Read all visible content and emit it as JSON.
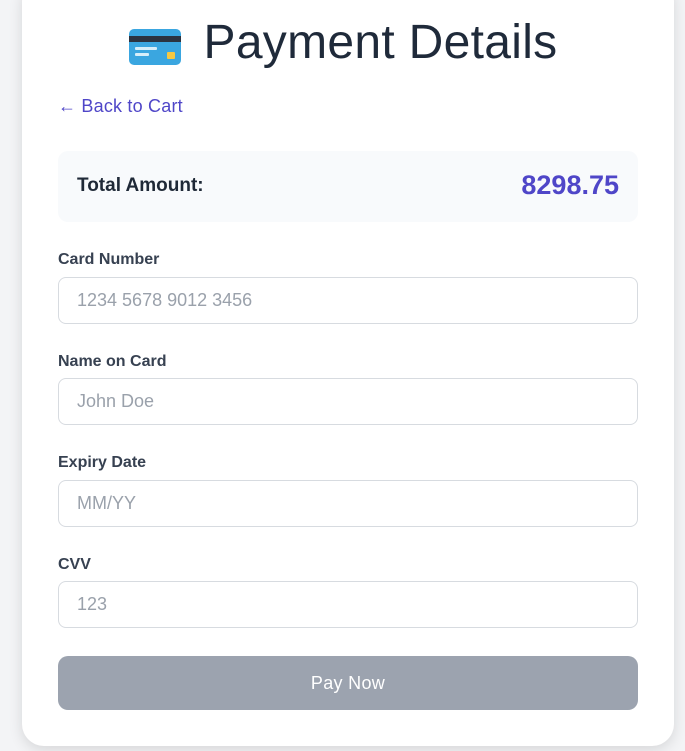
{
  "header": {
    "icon": "credit-card-icon",
    "title": "Payment Details"
  },
  "nav": {
    "back_label": "← Back to Cart"
  },
  "summary": {
    "total_label": "Total Amount:",
    "total_value": "8298.75"
  },
  "form": {
    "card_number": {
      "label": "Card Number",
      "placeholder": "1234 5678 9012 3456",
      "value": ""
    },
    "name_on_card": {
      "label": "Name on Card",
      "placeholder": "John Doe",
      "value": ""
    },
    "expiry_date": {
      "label": "Expiry Date",
      "placeholder": "MM/YY",
      "value": ""
    },
    "cvv": {
      "label": "CVV",
      "placeholder": "123",
      "value": ""
    }
  },
  "actions": {
    "pay_label": "Pay Now",
    "pay_state": "disabled"
  },
  "colors": {
    "accent": "#4f46c8",
    "button_disabled": "#9ca3af",
    "summary_bg": "#f8fafc"
  }
}
